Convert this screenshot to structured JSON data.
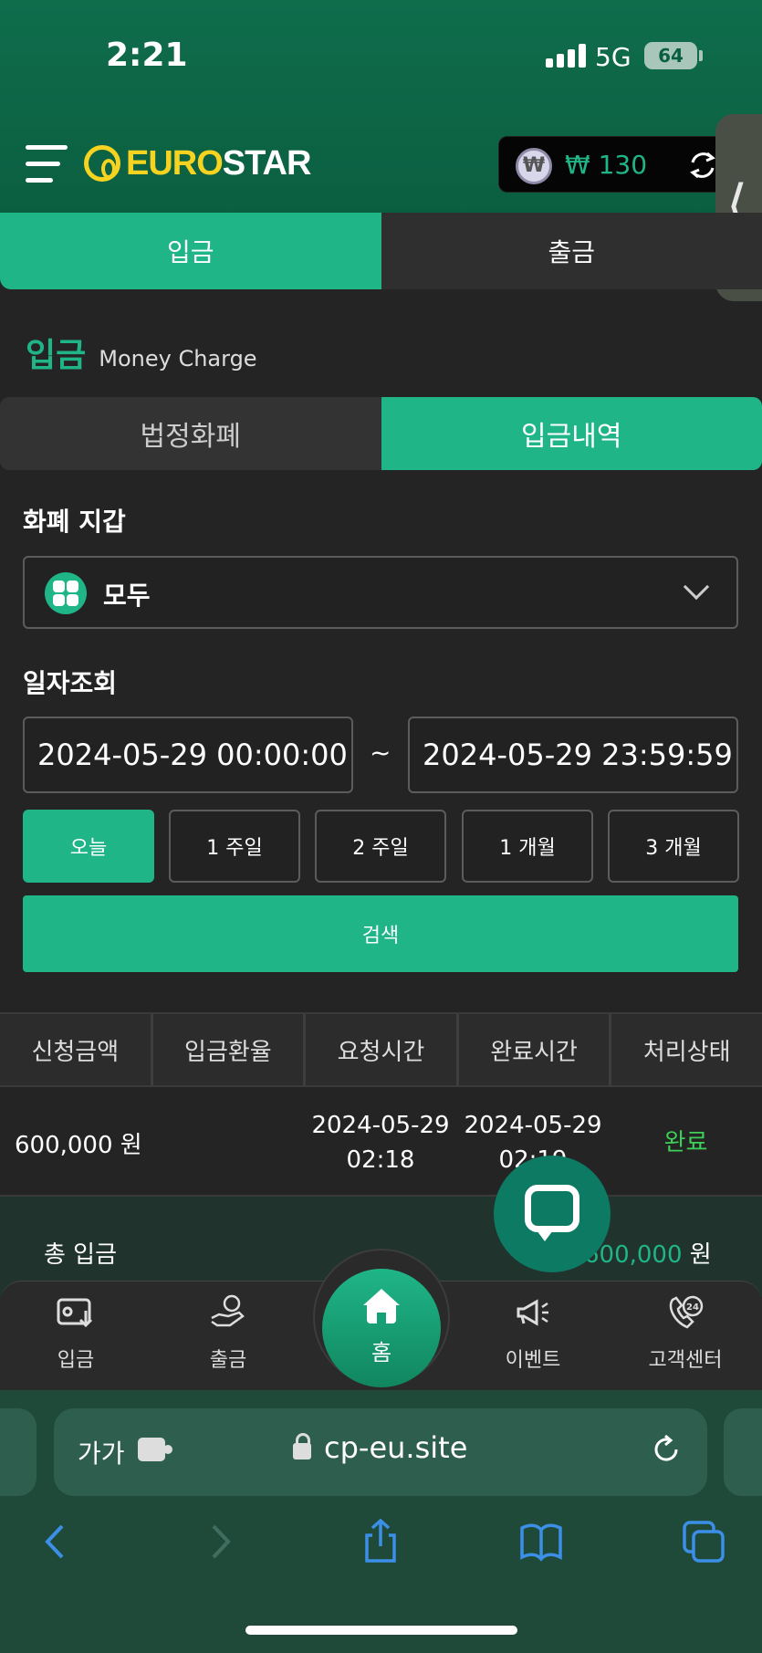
{
  "status_bar": {
    "time": "2:21",
    "network": "5G",
    "battery": "64"
  },
  "header": {
    "logo_euro": "EURO",
    "logo_star": "STAR",
    "currency_symbol": "₩",
    "balance": "₩ 130"
  },
  "main_tabs": [
    {
      "label": "입금",
      "active": true
    },
    {
      "label": "출금",
      "active": false
    }
  ],
  "section": {
    "title": "입금",
    "subtitle": "Money Charge"
  },
  "sub_tabs": [
    {
      "label": "법정화폐",
      "active": false
    },
    {
      "label": "입금내역",
      "active": true
    }
  ],
  "wallet_filter": {
    "label": "화폐 지갑",
    "selected": "모두"
  },
  "date_filter": {
    "label": "일자조회",
    "start": "2024-05-29 00:00:00",
    "end": "2024-05-29 23:59:59",
    "separator": "~"
  },
  "periods": [
    {
      "label": "오늘",
      "active": true
    },
    {
      "label": "1 주일",
      "active": false
    },
    {
      "label": "2 주일",
      "active": false
    },
    {
      "label": "1 개월",
      "active": false
    },
    {
      "label": "3 개월",
      "active": false
    }
  ],
  "search_label": "검색",
  "table": {
    "headers": [
      "신청금액",
      "입금환율",
      "요청시간",
      "완료시간",
      "처리상태"
    ],
    "rows": [
      {
        "amount": "600,000 원",
        "rate": "",
        "request_date": "2024-05-29",
        "request_time": "02:18",
        "complete_date": "2024-05-29",
        "complete_time": "02:19",
        "status": "완료"
      }
    ]
  },
  "total": {
    "label": "총 입금",
    "value": "600,000",
    "unit": "원"
  },
  "bottom_nav": [
    {
      "label": "입금",
      "icon": "deposit-icon"
    },
    {
      "label": "출금",
      "icon": "withdraw-icon"
    },
    {
      "label": "홈",
      "icon": "home-icon"
    },
    {
      "label": "이벤트",
      "icon": "megaphone-icon"
    },
    {
      "label": "고객센터",
      "icon": "support-24-icon"
    }
  ],
  "browser": {
    "aa": "가가",
    "url": "cp-eu.site"
  },
  "colors": {
    "brand": "#1fb587",
    "header_bg": "#0f6d4c",
    "logo_yellow": "#f5d320",
    "status_done": "#3ecf59"
  }
}
